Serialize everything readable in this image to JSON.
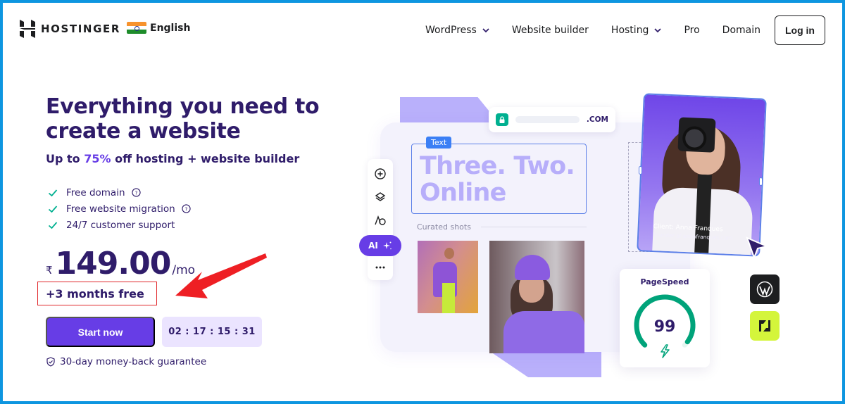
{
  "header": {
    "brand": "HOSTINGER",
    "language": "English",
    "nav": [
      {
        "label": "WordPress",
        "has_dropdown": true
      },
      {
        "label": "Website builder",
        "has_dropdown": false
      },
      {
        "label": "Hosting",
        "has_dropdown": true
      },
      {
        "label": "Pro",
        "has_dropdown": false
      },
      {
        "label": "Domain",
        "has_dropdown": false
      }
    ],
    "login_label": "Log in"
  },
  "hero": {
    "title": "Everything you need to create a website",
    "subtitle_prefix": "Up to ",
    "subtitle_accent": "75%",
    "subtitle_suffix": " off hosting + website builder",
    "features": [
      {
        "label": "Free domain",
        "has_help": true
      },
      {
        "label": "Free website migration",
        "has_help": true
      },
      {
        "label": "24/7 customer support",
        "has_help": false
      }
    ],
    "currency": "₹",
    "price": "149.00",
    "period": "/mo",
    "promo": "+3 months free",
    "cta_label": "Start now",
    "countdown": "02 : 17 : 15 : 31",
    "guarantee": "30-day money-back guarantee"
  },
  "illustration": {
    "url_tld": ".COM",
    "text_tag": "Text",
    "headline_line1": "Three. Two.",
    "headline_line2": "Online",
    "curated_label": "Curated shots",
    "ai_label": "AI",
    "client_name": "Client: Anna Franques",
    "client_sub": "Founder of annafranques.com",
    "pagespeed_title": "PageSpeed",
    "pagespeed_score": "99",
    "pagespeed_value": 99
  },
  "colors": {
    "brand_purple": "#673de6",
    "dark_text": "#2f1c6a",
    "check_green": "#00b090",
    "annotation_red": "#e0262a",
    "timer_bg": "#ebe4ff",
    "frame_blue": "#0e96e0"
  }
}
